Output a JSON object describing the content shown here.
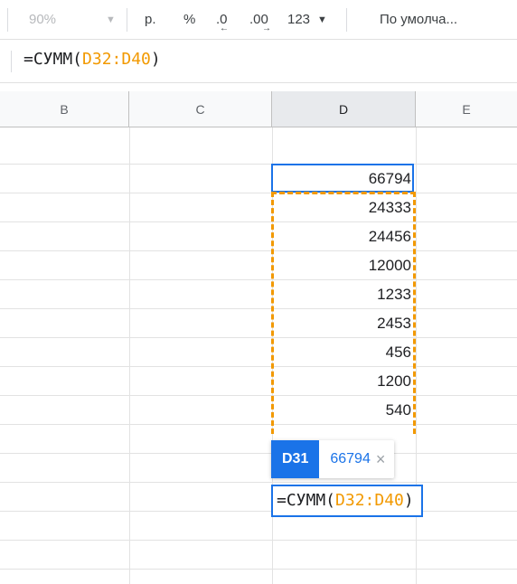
{
  "toolbar": {
    "zoom": "90%",
    "zoom_arrow": "▼",
    "currency": "р.",
    "percent": "%",
    "decrease_decimals": ".0",
    "increase_decimals": ".00",
    "number_format": "123",
    "number_format_arrow": "▼",
    "font": "По умолча..."
  },
  "formula_bar": {
    "prefix": "=СУММ(",
    "range": "D32:D40",
    "suffix": ")"
  },
  "columns": [
    {
      "label": "B"
    },
    {
      "label": "C"
    },
    {
      "label": "D"
    },
    {
      "label": "E"
    }
  ],
  "cells": {
    "d31": "66794",
    "values": [
      "24333",
      "24456",
      "12000",
      "1233",
      "2453",
      "456",
      "1200",
      "540"
    ]
  },
  "tooltip": {
    "ref": "D31",
    "value": "66794",
    "close": "×"
  },
  "editor": {
    "prefix": "=СУММ(",
    "range": "D32:D40",
    "suffix": ")"
  },
  "colors": {
    "accent": "#1a73e8",
    "range": "#f29900"
  }
}
